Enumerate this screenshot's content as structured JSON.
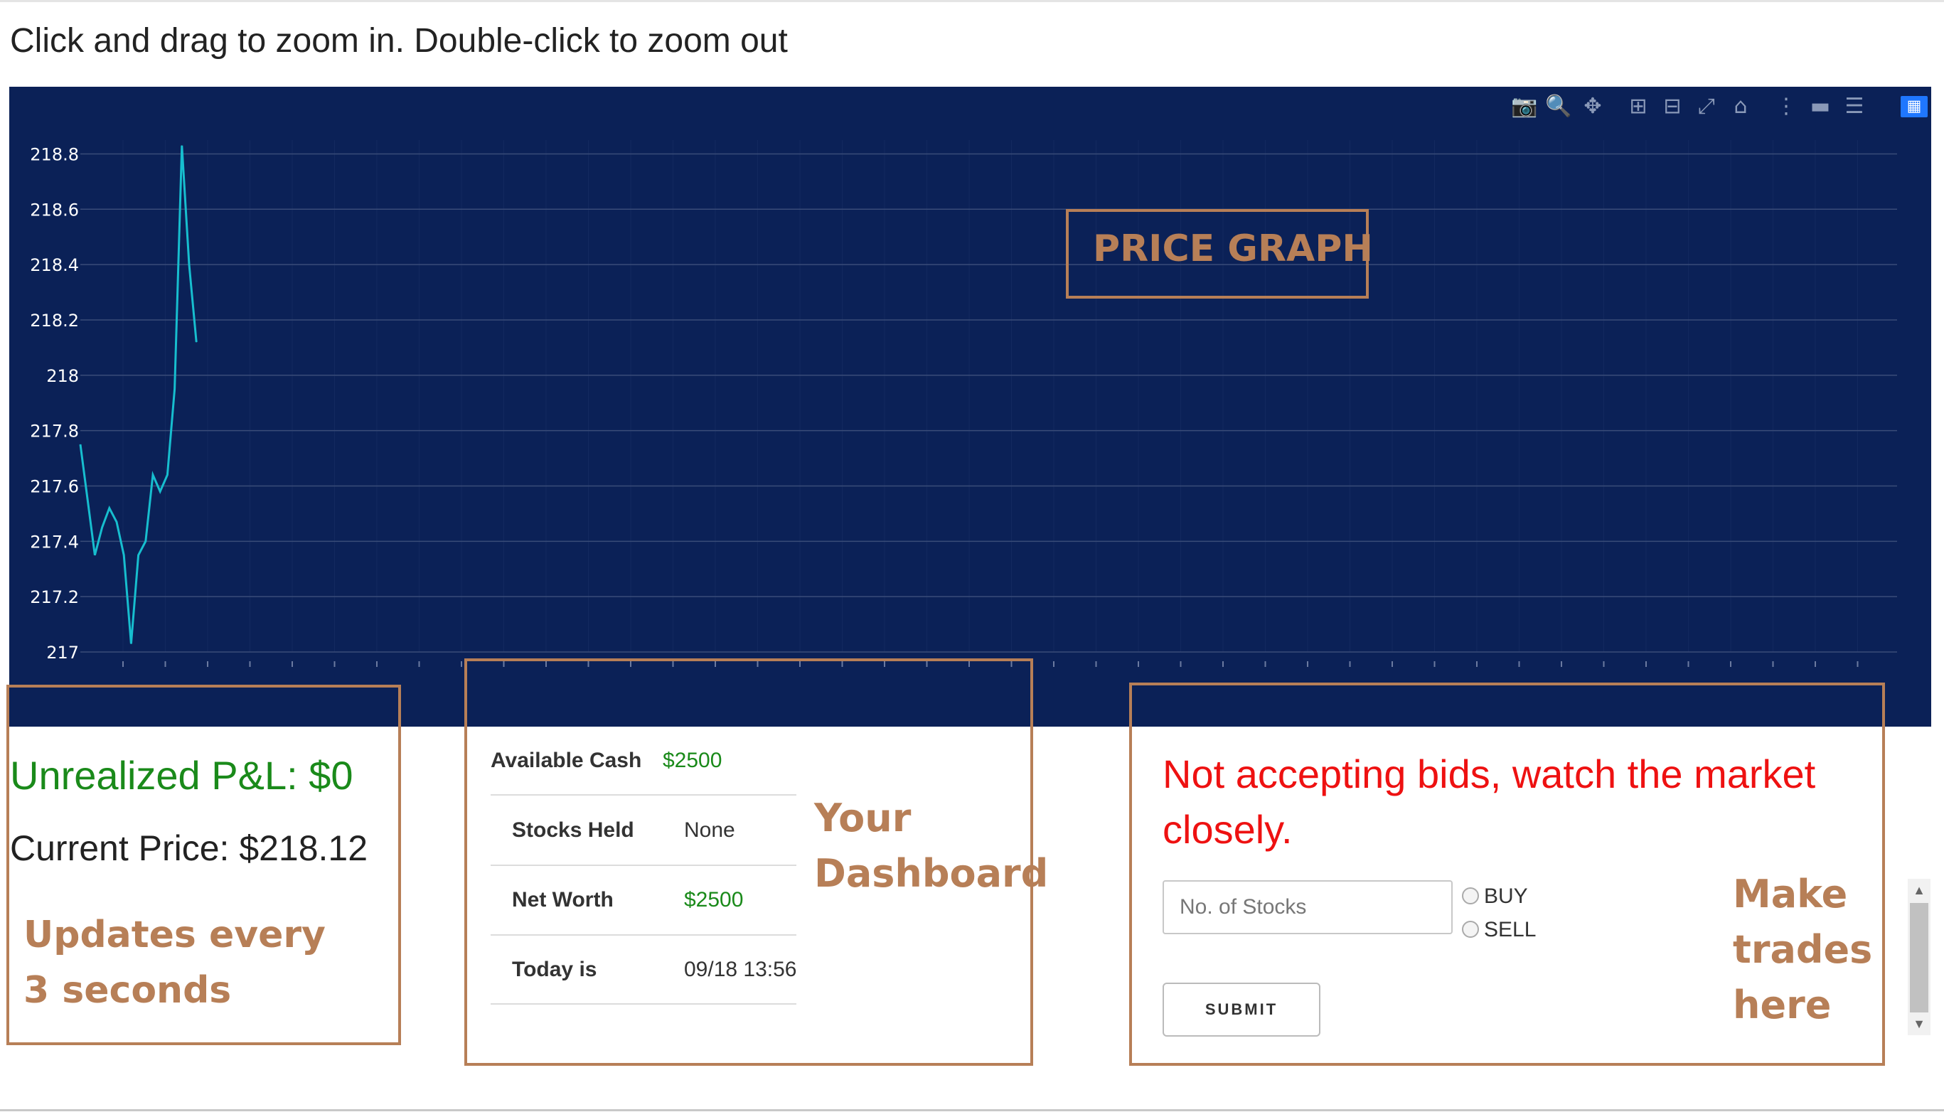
{
  "instructions": "Click and drag to zoom in. Double-click to zoom out",
  "chart_data": {
    "type": "line",
    "title": "",
    "xlabel": "",
    "ylabel": "",
    "ylim": [
      217,
      218.85
    ],
    "y_ticks": [
      "218.8",
      "218.6",
      "218.4",
      "218.2",
      "218",
      "217.8",
      "217.6",
      "217.4",
      "217.2",
      "217"
    ],
    "grid": true,
    "line_color": "#17becf",
    "background_color": "#0b2157",
    "series": [
      {
        "values": [
          217.75,
          217.55,
          217.35,
          217.45,
          217.52,
          217.47,
          217.35,
          217.03,
          217.35,
          217.4,
          217.64,
          217.58,
          217.64,
          217.95,
          218.83,
          218.4,
          218.12
        ]
      }
    ]
  },
  "modebar": {
    "icons": [
      "camera-icon",
      "zoom-icon",
      "pan-icon",
      "zoom-in-icon",
      "zoom-out-icon",
      "autoscale-icon",
      "reset-axes-icon",
      "spike-lines-icon",
      "hover-closest-icon",
      "hover-compare-icon",
      "plotly-logo-icon"
    ]
  },
  "annotations": {
    "price_graph": "PRICE GRAPH",
    "updates": "Updates every 3 seconds",
    "dashboard": "Your Dashboard",
    "make_trades": "Make trades here"
  },
  "pnl": {
    "unrealized": "Unrealized P&L: $0",
    "current_price": "Current Price: $218.12"
  },
  "dashboard": {
    "available_cash_label": "Available Cash",
    "available_cash_value": "$2500",
    "stocks_held_label": "Stocks Held",
    "stocks_held_value": "None",
    "net_worth_label": "Net Worth",
    "net_worth_value": "$2500",
    "today_label": "Today is",
    "today_value": "09/18 13:56"
  },
  "trade": {
    "status_message": "Not accepting bids, watch the market closely.",
    "stocks_placeholder": "No. of Stocks",
    "buy_label": "BUY",
    "sell_label": "SELL",
    "submit_label": "SUBMIT"
  },
  "colors": {
    "accent": "#b77f57",
    "positive": "#1a8a1a",
    "alert": "#ee1111"
  }
}
